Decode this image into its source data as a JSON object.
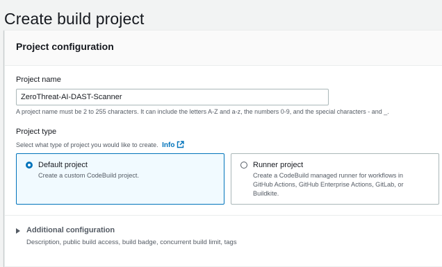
{
  "page": {
    "title": "Create build project"
  },
  "section": {
    "title": "Project configuration"
  },
  "project_name": {
    "label": "Project name",
    "value": "ZeroThreat-AI-DAST-Scanner",
    "hint": "A project name must be 2 to 255 characters. It can include the letters A-Z and a-z, the numbers 0-9, and the special characters - and _."
  },
  "project_type": {
    "label": "Project type",
    "description": "Select what type of project you would like to create.",
    "info_link": "Info",
    "options": [
      {
        "title": "Default project",
        "description": "Create a custom CodeBuild project.",
        "selected": true
      },
      {
        "title": "Runner project",
        "description": "Create a CodeBuild managed runner for workflows in GitHub Actions, GitHub Enterprise Actions, GitLab, or Buildkite.",
        "selected": false
      }
    ]
  },
  "additional_config": {
    "title": "Additional configuration",
    "description": "Description, public build access, build badge, concurrent build limit, tags"
  },
  "colors": {
    "accent": "#0073bb",
    "selected_tile_bg": "#f1faff",
    "text": "#16191f",
    "secondary_text": "#545b64"
  }
}
